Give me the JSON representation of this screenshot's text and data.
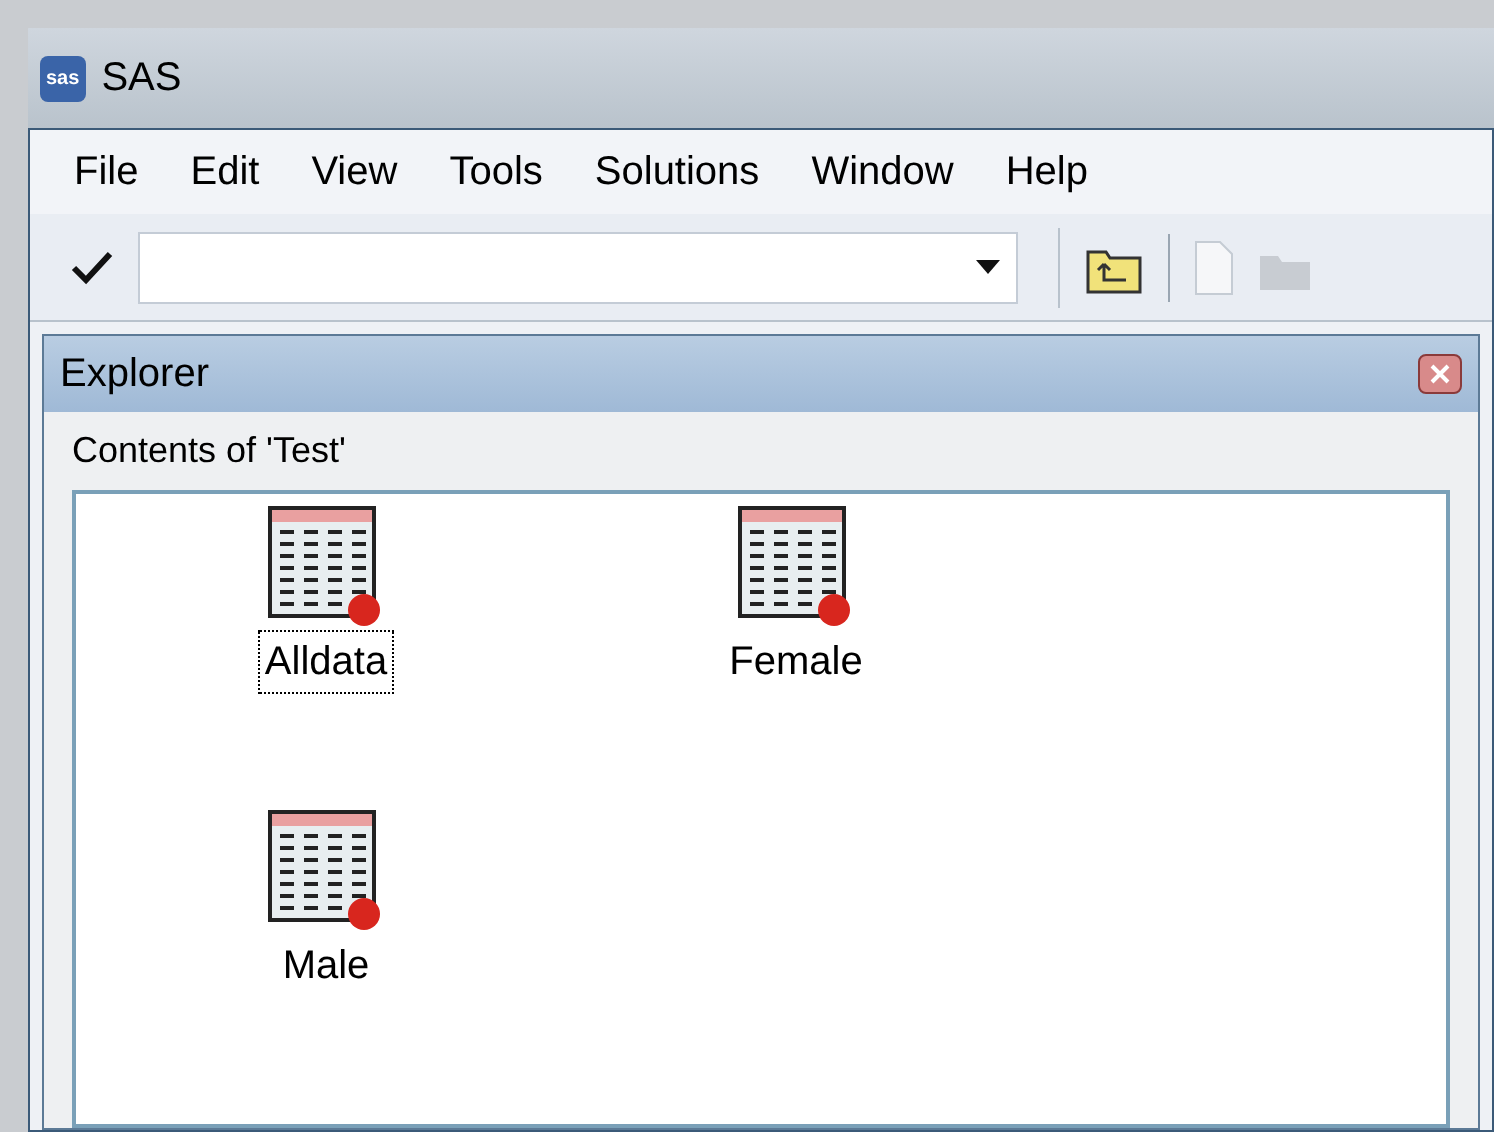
{
  "window": {
    "logo": "sas",
    "title": "SAS"
  },
  "menu": [
    "File",
    "Edit",
    "View",
    "Tools",
    "Solutions",
    "Window",
    "Help"
  ],
  "explorer": {
    "title": "Explorer",
    "heading": "Contents of 'Test'",
    "items": [
      {
        "label": "Alldata",
        "selected": true
      },
      {
        "label": "Female",
        "selected": false
      },
      {
        "label": "Male",
        "selected": false
      }
    ]
  }
}
